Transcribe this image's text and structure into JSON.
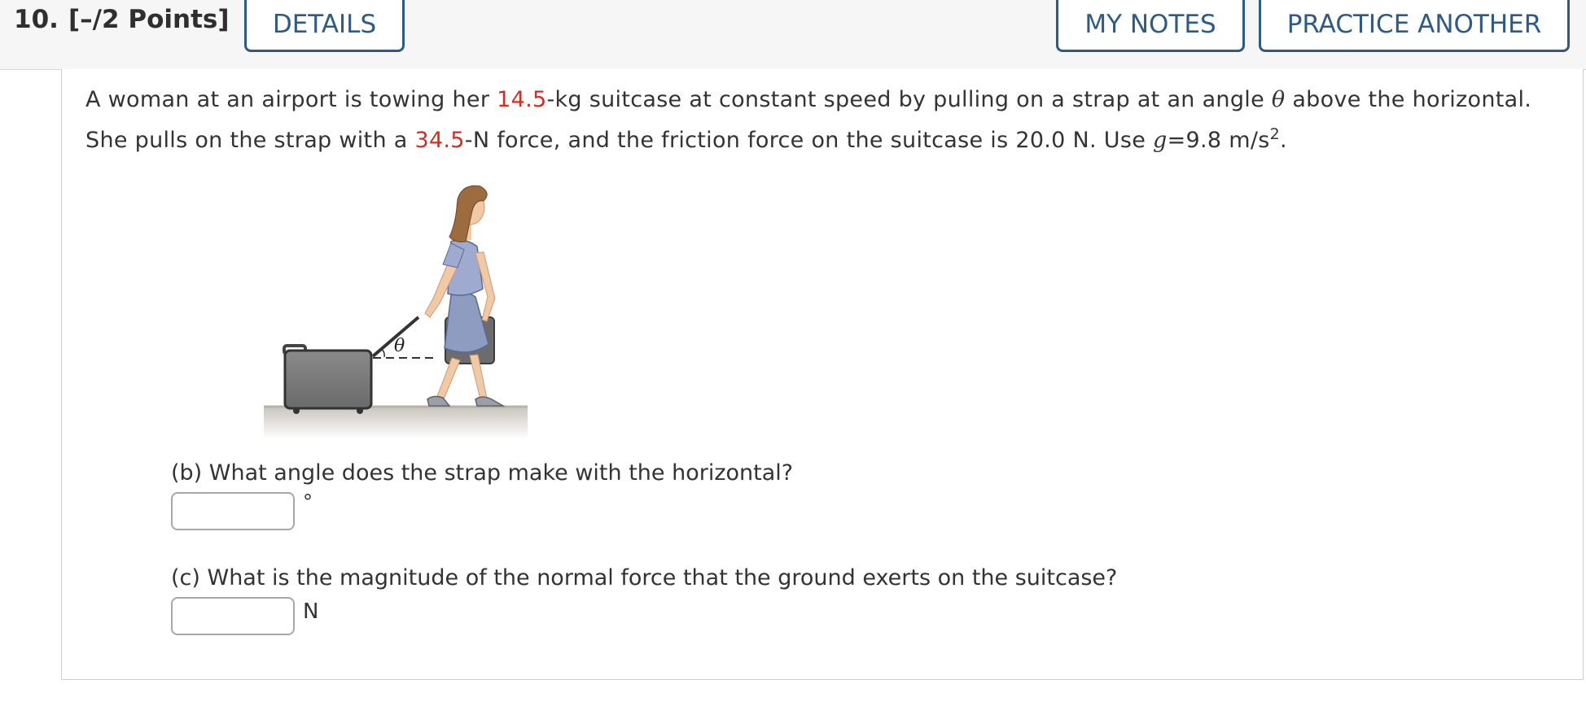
{
  "header": {
    "question_number": "10.",
    "points": "[–/2 Points]",
    "details_label": "DETAILS",
    "my_notes_label": "MY NOTES",
    "practice_another_label": "PRACTICE ANOTHER"
  },
  "problem": {
    "text_1": "A woman at an airport is towing her ",
    "mass": "14.5",
    "text_2": "-kg suitcase at constant speed by pulling on a strap at an angle ",
    "theta": "θ",
    "text_3": " above the horizontal. She pulls on the strap with a ",
    "force": "34.5",
    "text_4": "-N force, and the friction force on the suitcase is 20.0 N. Use ",
    "g_symbol": "g",
    "text_5": "=9.8 m/s",
    "exp": "2",
    "text_6": "."
  },
  "figure": {
    "angle_label": "θ"
  },
  "parts": {
    "b": {
      "question": "(b) What angle does the strap make with the horizontal?",
      "unit": "°",
      "value": ""
    },
    "c": {
      "question": "(c) What is the magnitude of the normal force that the ground exerts on the suitcase?",
      "unit": "N",
      "value": ""
    }
  },
  "colors": {
    "accent": "#2e5a87",
    "highlight": "#d62d20"
  }
}
